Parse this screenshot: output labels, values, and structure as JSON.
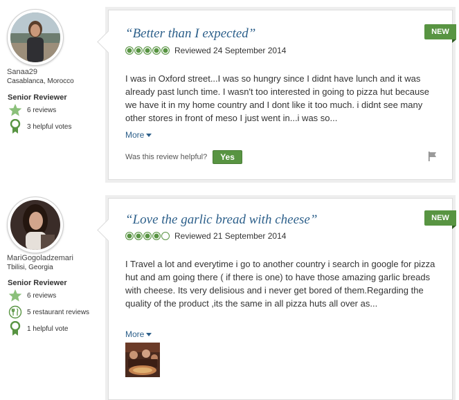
{
  "reviews": [
    {
      "user": {
        "name": "Sanaa29",
        "location": "Casablanca, Morocco",
        "level": "Senior Reviewer",
        "stats": [
          {
            "icon": "star-icon",
            "text": "6 reviews"
          },
          {
            "icon": "ribbon-icon",
            "text": "3 helpful votes"
          }
        ]
      },
      "badge": "NEW",
      "title": "“Better than I expected”",
      "rating": 5,
      "date": "Reviewed 24 September 2014",
      "body": "I was in Oxford street...I was so hungry since I didnt have lunch and it was already past lunch time. I wasn't too interested in going to pizza hut because we have it in my home country and I dont like it too much. i didnt see many other stores in front of meso I just went in...i was so...",
      "more": "More",
      "helpful_q": "Was this review helpful?",
      "yes": "Yes"
    },
    {
      "user": {
        "name": "MariGogoladzemari",
        "location": "Tbilisi, Georgia",
        "level": "Senior Reviewer",
        "stats": [
          {
            "icon": "star-icon",
            "text": "6 reviews"
          },
          {
            "icon": "fork-knife-icon",
            "text": "5 restaurant reviews"
          },
          {
            "icon": "ribbon-icon",
            "text": "1 helpful vote"
          }
        ]
      },
      "badge": "NEW",
      "title": "“Love the garlic bread with cheese”",
      "rating": 4,
      "date": "Reviewed 21 September 2014",
      "body": "I Travel a lot and everytime i go to another country i search in google for pizza hut and am going there ( if there is one) to have those amazing garlic breads with cheese. Its very delisious and i never get bored of them.Regarding the quality of the product ,its the same in all pizza huts all over as...",
      "more": "More"
    }
  ],
  "colors": {
    "green": "#589442",
    "link": "#2c5f8a"
  }
}
